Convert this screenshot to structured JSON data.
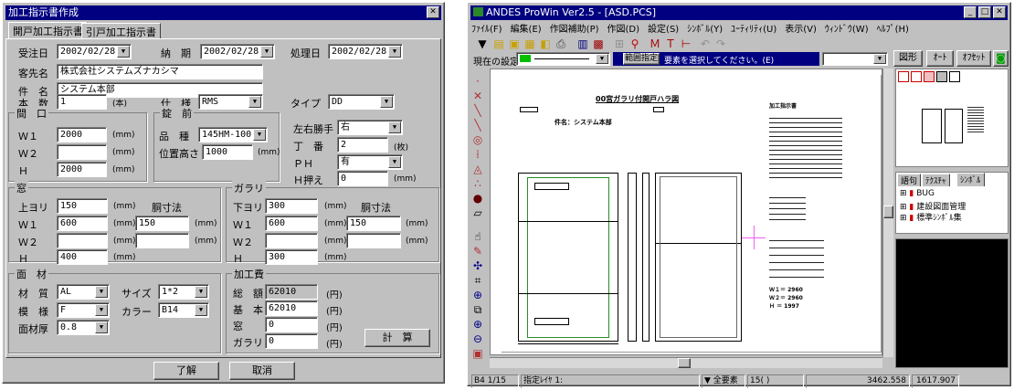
{
  "dialog": {
    "title": "加工指示書作成",
    "tabs": [
      "開戸加工指示書",
      "引戸加工指示書"
    ],
    "receive_label": "受注日",
    "receive_date": "2002/02/28",
    "deadline_label": "納　期",
    "deadline_date": "2002/02/28",
    "process_label": "処理日",
    "process_date": "2002/02/28",
    "client_label": "客先名",
    "client": "株式会社システムズナカシマ",
    "subject_label": "件　名",
    "subject": "システム本部",
    "count_label": "本　数",
    "count": "1",
    "count_unit": "(本)",
    "spec_label": "仕　様",
    "spec": "RMS",
    "type_label": "タイプ",
    "type": "DD",
    "opening": {
      "title": "間　口",
      "w1_label": "Ｗ１",
      "w1": "2000",
      "w2_label": "Ｗ２",
      "w2": "",
      "h_label": "Ｈ",
      "h": "2000",
      "unit": "(mm)"
    },
    "lock": {
      "title": "錠　前",
      "model_label": "品　種",
      "model": "145HM-100",
      "height_label": "位置高さ",
      "height": "1000",
      "unit": "(mm)"
    },
    "hinge": {
      "lr_label": "左右勝手",
      "lr": "右",
      "count_label": "丁　番",
      "count": "2",
      "count_unit": "(枚)",
      "ph_label": "ＰＨ",
      "ph": "有",
      "hpress_label": "Ｈ押え",
      "hpress": "0",
      "unit": "(mm)"
    },
    "window": {
      "title": "窓",
      "top_label": "上ヨリ",
      "top": "150",
      "dim_label": "胴寸法",
      "w1_label": "Ｗ１",
      "w1": "600",
      "w1_side": "150",
      "w2_label": "Ｗ２",
      "w2": "",
      "w2_side": "",
      "h_label": "Ｈ",
      "h": "400",
      "unit": "(mm)"
    },
    "glass": {
      "title": "ガラリ",
      "bottom_label": "下ヨリ",
      "bottom": "300",
      "dim_label": "胴寸法",
      "w1_label": "Ｗ１",
      "w1": "600",
      "w1_side": "150",
      "w2_label": "Ｗ２",
      "w2": "",
      "w2_side": "",
      "h_label": "Ｈ",
      "h": "300",
      "unit": "(mm)"
    },
    "face": {
      "title": "面　材",
      "material_label": "材　質",
      "material": "AL",
      "size_label": "サイズ",
      "size": "1*2",
      "pattern_label": "模　様",
      "pattern": "F",
      "color_label": "カラー",
      "color": "B14",
      "thick_label": "面材厚",
      "thick": "0.8"
    },
    "cost": {
      "title": "加工費",
      "total_label": "総　額",
      "total": "62010",
      "base_label": "基　本",
      "base": "62010",
      "window_label": "窓",
      "window": "0",
      "glass_label": "ガラリ",
      "glass": "0",
      "yen": "(円)",
      "calc_button": "計　算"
    },
    "ok_button": "了解",
    "cancel_button": "取消"
  },
  "app": {
    "title": "ANDES ProWin Ver2.5 - [ASD.PCS]",
    "menu": [
      "ﾌｧｲﾙ(F)",
      "編集(E)",
      "作図補助(P)",
      "作図(D)",
      "設定(S)",
      "ｼﾝﾎﾞﾙ(Y)",
      "ﾕｰﾃｨﾘﾃｨ(U)",
      "表示(V)",
      "ｳｨﾝﾄﾞｳ(W)",
      "ﾍﾙﾌﾟ(H)"
    ],
    "current_setting_label": "現在の設定",
    "range_button": "範囲指定",
    "prompt": "要素を選択してください。(E)",
    "shape_button": "図形",
    "auto_button": "ｵｰﾄ",
    "offset_button": "ｵﾌｾｯﾄ",
    "drawing": {
      "title": "00宮ガラリ付開戸ハラ図",
      "sub": "件名：システム本部",
      "block1": "加工指示書",
      "w1": "Ｗ１＝ 2960",
      "w2": "Ｗ２＝ 2960",
      "h": "Ｈ ＝ 1997"
    },
    "panel_tabs": [
      "語句",
      "ﾃｸｽﾁｬ",
      "ｼﾝﾎﾞﾙ"
    ],
    "tree": [
      "BUG",
      "建設図面管理",
      "標準ｼﾝﾎﾞﾙ集"
    ],
    "status": {
      "paper": "B4 1/15",
      "layer_label": "指定ﾚｲﾔ 1:",
      "all": "全要素",
      "angle": "15(  )",
      "x": "3462.558",
      "y": "1617.907"
    }
  }
}
